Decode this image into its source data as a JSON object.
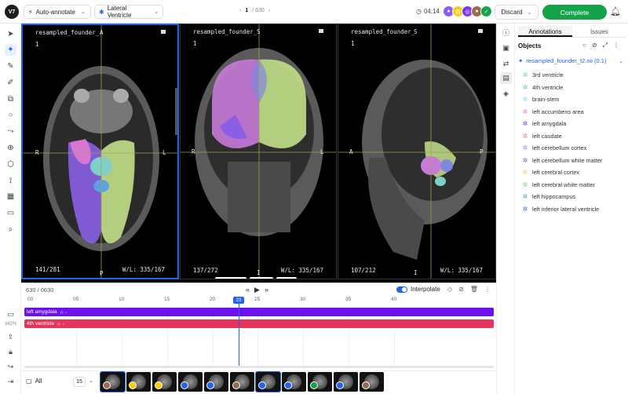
{
  "header": {
    "logo": "V7",
    "mode_label": "Auto-annotate",
    "class_label": "Lateral Ventricle",
    "page_current": "1",
    "page_total": "/ 630",
    "timer": "04:14",
    "discard_label": "Discard",
    "complete_label": "Complete"
  },
  "viewer": {
    "panes": [
      {
        "filename": "resampled_founder_",
        "index": "1",
        "top": "A",
        "bottom": "P",
        "left": "R",
        "right": "L",
        "slice": "141/281",
        "wl": "W/L: 335/167"
      },
      {
        "filename": "resampled_founder_",
        "index": "1",
        "top": "S",
        "bottom": "I",
        "left": "R",
        "right": "L",
        "slice": "137/272",
        "wl": "W/L: 335/167"
      },
      {
        "filename": "resampled_founder_",
        "index": "1",
        "top": "S",
        "bottom": "I",
        "left": "A",
        "right": "P",
        "slice": "107/212",
        "wl": "W/L: 335/167"
      }
    ]
  },
  "timeline": {
    "frames": "630 / 0630",
    "interpolate_label": "Interpolate",
    "ticks": [
      "00",
      "05",
      "10",
      "15",
      "20",
      "25",
      "30",
      "35",
      "40"
    ],
    "current_frame": "23",
    "zoom": "342%",
    "tracks": [
      {
        "label": "left amygdala",
        "color": "#6d10f0"
      },
      {
        "label": "4th ventricle",
        "color": "#e8335a"
      }
    ]
  },
  "bottom": {
    "filter_label": "All",
    "count": "15"
  },
  "panel": {
    "tabs": [
      "Annotations",
      "Issues"
    ],
    "objects_label": "Objects",
    "file_label": "resampled_founder_t2.nii (0.1)",
    "objects": [
      {
        "name": "3rd ventricle",
        "color": "#7fc97f"
      },
      {
        "name": "4th ventricle",
        "color": "#6cc2b6"
      },
      {
        "name": "brain-stem",
        "color": "#8fd3e8"
      },
      {
        "name": "left accumbens area",
        "color": "#e377c2"
      },
      {
        "name": "left amygdala",
        "color": "#7b3fe4"
      },
      {
        "name": "left caudate",
        "color": "#e377c2"
      },
      {
        "name": "left cerebellum cortex",
        "color": "#b07be0"
      },
      {
        "name": "left cerebellum white matter",
        "color": "#5b6bd6"
      },
      {
        "name": "left cerebral cortex",
        "color": "#f0d060"
      },
      {
        "name": "left cerebral white matter",
        "color": "#7fc97f"
      },
      {
        "name": "left hippocampus",
        "color": "#4aa3b8"
      },
      {
        "name": "left inferior lateral ventricle",
        "color": "#3b6fd6"
      }
    ]
  }
}
